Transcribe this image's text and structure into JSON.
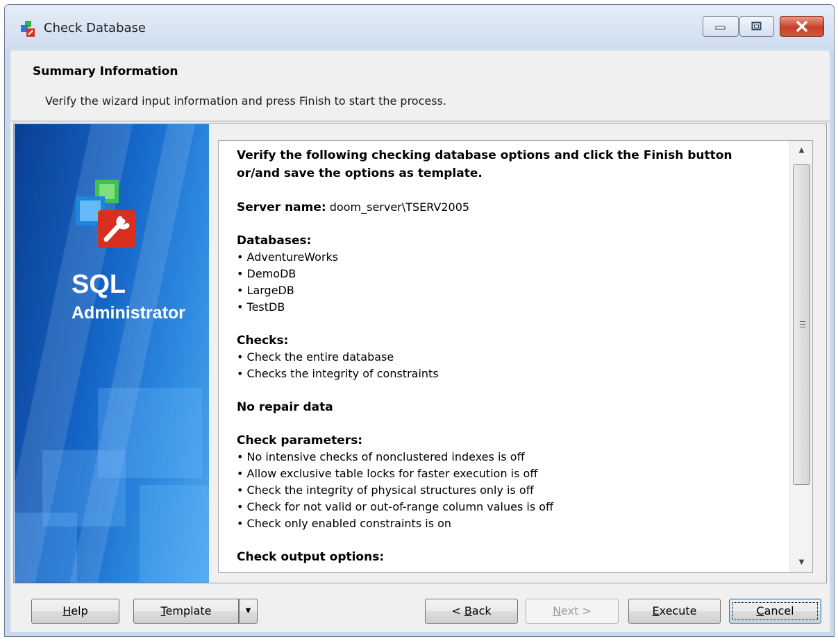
{
  "window": {
    "title": "Check Database"
  },
  "header": {
    "title": "Summary Information",
    "subtitle": "Verify the wizard input information and press Finish to start the process."
  },
  "banner": {
    "line1": "SQL",
    "line2": "Administrator"
  },
  "summary": {
    "intro": "Verify the following checking database options and click the Finish button or/and save the options as template.",
    "server_label": "Server name:",
    "server_value": "doom_server\\TSERV2005",
    "databases_heading": "Databases:",
    "databases": [
      "AdventureWorks",
      "DemoDB",
      "LargeDB",
      "TestDB"
    ],
    "checks_heading": "Checks:",
    "checks": [
      "Check the entire database",
      "Checks the integrity of constraints"
    ],
    "repair_heading": "No repair data",
    "params_heading": "Check parameters:",
    "params": [
      "No intensive checks of nonclustered indexes is off",
      "Allow exclusive table locks for faster execution is off",
      "Check the integrity of physical structures only is off",
      "Check for not valid or out-of-range column values is off",
      "Check only enabled constraints is on"
    ],
    "output_heading": "Check output options:"
  },
  "buttons": {
    "help": {
      "pre": "",
      "key": "H",
      "post": "elp"
    },
    "template": {
      "pre": "",
      "key": "T",
      "post": "emplate"
    },
    "back": {
      "pre": "< ",
      "key": "B",
      "post": "ack"
    },
    "next": {
      "pre": "",
      "key": "N",
      "post": "ext >"
    },
    "execute": {
      "pre": "",
      "key": "E",
      "post": "xecute"
    },
    "cancel": {
      "pre": "",
      "key": "C",
      "post": "ancel"
    }
  },
  "icons": {
    "app": "sql-administrator-icon",
    "dropdown": "chevron-down-icon"
  },
  "colors": {
    "banner": "#1566c8",
    "close_button": "#c6412c"
  }
}
